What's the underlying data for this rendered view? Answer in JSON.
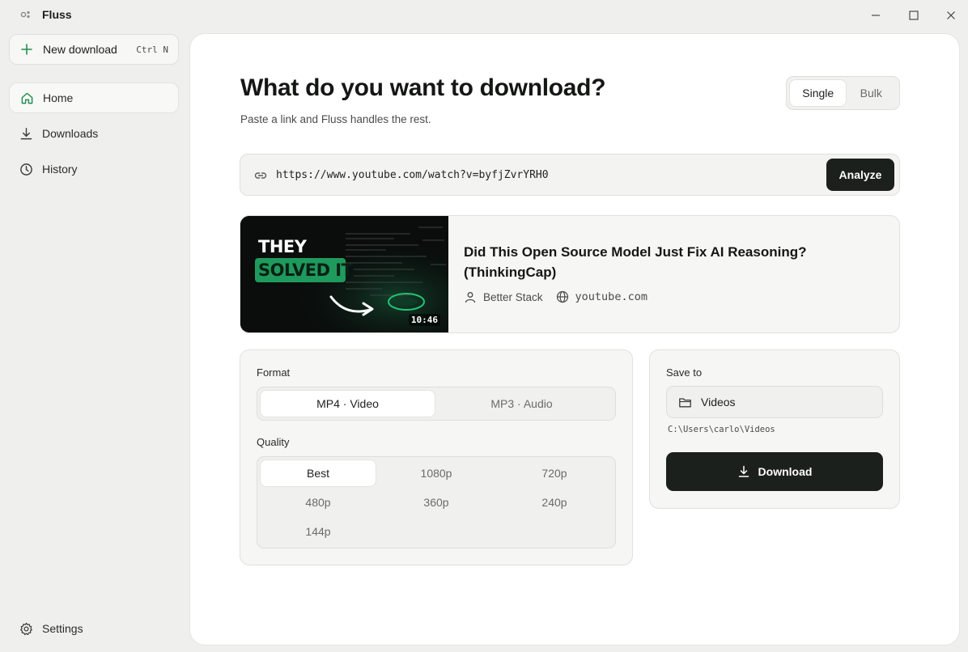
{
  "app": {
    "title": "Fluss"
  },
  "titlebar": {
    "minimize_icon": "minimize-icon",
    "maximize_icon": "maximize-icon",
    "close_icon": "close-icon"
  },
  "sidebar": {
    "new_download": {
      "label": "New download",
      "shortcut": "Ctrl N",
      "icon": "plus-icon"
    },
    "items": [
      {
        "label": "Home",
        "icon": "home-icon",
        "active": true
      },
      {
        "label": "Downloads",
        "icon": "download-icon",
        "active": false
      },
      {
        "label": "History",
        "icon": "clock-icon",
        "active": false
      }
    ],
    "settings": {
      "label": "Settings",
      "icon": "gear-icon"
    }
  },
  "main": {
    "heading": "What do you want to download?",
    "subheading": "Paste a link and Fluss handles the rest.",
    "mode_toggle": {
      "options": [
        "Single",
        "Bulk"
      ],
      "selected": "Single"
    },
    "url": {
      "value": "https://www.youtube.com/watch?v=byfjZvrYRH0",
      "icon": "link-icon"
    },
    "analyze_label": "Analyze",
    "video": {
      "title": "Did This Open Source Model Just Fix AI Reasoning? (ThinkingCap)",
      "author": "Better Stack",
      "source": "youtube.com",
      "duration": "10:46",
      "thumbnail_text": {
        "line1": "THEY",
        "line2": "SOLVED IT"
      },
      "accent_color": "#22c274"
    },
    "format": {
      "label": "Format",
      "options": [
        "MP4 · Video",
        "MP3 · Audio"
      ],
      "selected": "MP4 · Video"
    },
    "quality": {
      "label": "Quality",
      "options": [
        "Best",
        "1080p",
        "720p",
        "480p",
        "360p",
        "240p",
        "144p"
      ],
      "selected": "Best"
    },
    "save_to": {
      "label": "Save to",
      "folder": "Videos",
      "path": "C:\\Users\\carlo\\Videos",
      "folder_icon": "folder-icon"
    },
    "download_label": "Download"
  },
  "colors": {
    "accent_green": "#1f8f4e",
    "dark_button": "#1c201d",
    "app_background": "#efefed"
  }
}
